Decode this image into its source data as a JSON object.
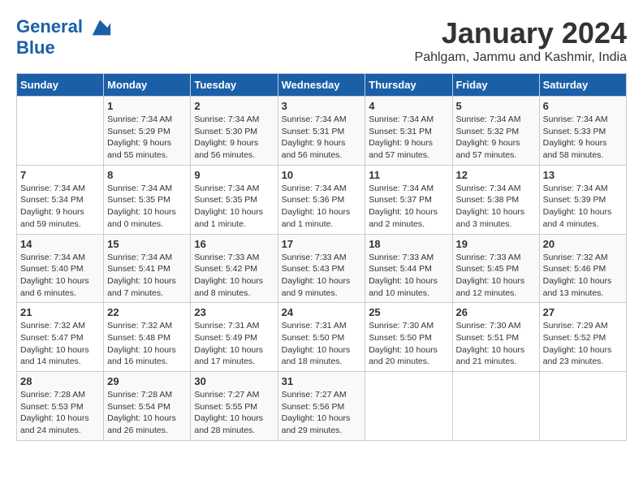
{
  "header": {
    "logo_line1": "General",
    "logo_line2": "Blue",
    "month_title": "January 2024",
    "subtitle": "Pahlgam, Jammu and Kashmir, India"
  },
  "days_of_week": [
    "Sunday",
    "Monday",
    "Tuesday",
    "Wednesday",
    "Thursday",
    "Friday",
    "Saturday"
  ],
  "weeks": [
    [
      {
        "day": "",
        "sunrise": "",
        "sunset": "",
        "daylight": ""
      },
      {
        "day": "1",
        "sunrise": "Sunrise: 7:34 AM",
        "sunset": "Sunset: 5:29 PM",
        "daylight": "Daylight: 9 hours and 55 minutes."
      },
      {
        "day": "2",
        "sunrise": "Sunrise: 7:34 AM",
        "sunset": "Sunset: 5:30 PM",
        "daylight": "Daylight: 9 hours and 56 minutes."
      },
      {
        "day": "3",
        "sunrise": "Sunrise: 7:34 AM",
        "sunset": "Sunset: 5:31 PM",
        "daylight": "Daylight: 9 hours and 56 minutes."
      },
      {
        "day": "4",
        "sunrise": "Sunrise: 7:34 AM",
        "sunset": "Sunset: 5:31 PM",
        "daylight": "Daylight: 9 hours and 57 minutes."
      },
      {
        "day": "5",
        "sunrise": "Sunrise: 7:34 AM",
        "sunset": "Sunset: 5:32 PM",
        "daylight": "Daylight: 9 hours and 57 minutes."
      },
      {
        "day": "6",
        "sunrise": "Sunrise: 7:34 AM",
        "sunset": "Sunset: 5:33 PM",
        "daylight": "Daylight: 9 hours and 58 minutes."
      }
    ],
    [
      {
        "day": "7",
        "sunrise": "Sunrise: 7:34 AM",
        "sunset": "Sunset: 5:34 PM",
        "daylight": "Daylight: 9 hours and 59 minutes."
      },
      {
        "day": "8",
        "sunrise": "Sunrise: 7:34 AM",
        "sunset": "Sunset: 5:35 PM",
        "daylight": "Daylight: 10 hours and 0 minutes."
      },
      {
        "day": "9",
        "sunrise": "Sunrise: 7:34 AM",
        "sunset": "Sunset: 5:35 PM",
        "daylight": "Daylight: 10 hours and 1 minute."
      },
      {
        "day": "10",
        "sunrise": "Sunrise: 7:34 AM",
        "sunset": "Sunset: 5:36 PM",
        "daylight": "Daylight: 10 hours and 1 minute."
      },
      {
        "day": "11",
        "sunrise": "Sunrise: 7:34 AM",
        "sunset": "Sunset: 5:37 PM",
        "daylight": "Daylight: 10 hours and 2 minutes."
      },
      {
        "day": "12",
        "sunrise": "Sunrise: 7:34 AM",
        "sunset": "Sunset: 5:38 PM",
        "daylight": "Daylight: 10 hours and 3 minutes."
      },
      {
        "day": "13",
        "sunrise": "Sunrise: 7:34 AM",
        "sunset": "Sunset: 5:39 PM",
        "daylight": "Daylight: 10 hours and 4 minutes."
      }
    ],
    [
      {
        "day": "14",
        "sunrise": "Sunrise: 7:34 AM",
        "sunset": "Sunset: 5:40 PM",
        "daylight": "Daylight: 10 hours and 6 minutes."
      },
      {
        "day": "15",
        "sunrise": "Sunrise: 7:34 AM",
        "sunset": "Sunset: 5:41 PM",
        "daylight": "Daylight: 10 hours and 7 minutes."
      },
      {
        "day": "16",
        "sunrise": "Sunrise: 7:33 AM",
        "sunset": "Sunset: 5:42 PM",
        "daylight": "Daylight: 10 hours and 8 minutes."
      },
      {
        "day": "17",
        "sunrise": "Sunrise: 7:33 AM",
        "sunset": "Sunset: 5:43 PM",
        "daylight": "Daylight: 10 hours and 9 minutes."
      },
      {
        "day": "18",
        "sunrise": "Sunrise: 7:33 AM",
        "sunset": "Sunset: 5:44 PM",
        "daylight": "Daylight: 10 hours and 10 minutes."
      },
      {
        "day": "19",
        "sunrise": "Sunrise: 7:33 AM",
        "sunset": "Sunset: 5:45 PM",
        "daylight": "Daylight: 10 hours and 12 minutes."
      },
      {
        "day": "20",
        "sunrise": "Sunrise: 7:32 AM",
        "sunset": "Sunset: 5:46 PM",
        "daylight": "Daylight: 10 hours and 13 minutes."
      }
    ],
    [
      {
        "day": "21",
        "sunrise": "Sunrise: 7:32 AM",
        "sunset": "Sunset: 5:47 PM",
        "daylight": "Daylight: 10 hours and 14 minutes."
      },
      {
        "day": "22",
        "sunrise": "Sunrise: 7:32 AM",
        "sunset": "Sunset: 5:48 PM",
        "daylight": "Daylight: 10 hours and 16 minutes."
      },
      {
        "day": "23",
        "sunrise": "Sunrise: 7:31 AM",
        "sunset": "Sunset: 5:49 PM",
        "daylight": "Daylight: 10 hours and 17 minutes."
      },
      {
        "day": "24",
        "sunrise": "Sunrise: 7:31 AM",
        "sunset": "Sunset: 5:50 PM",
        "daylight": "Daylight: 10 hours and 18 minutes."
      },
      {
        "day": "25",
        "sunrise": "Sunrise: 7:30 AM",
        "sunset": "Sunset: 5:50 PM",
        "daylight": "Daylight: 10 hours and 20 minutes."
      },
      {
        "day": "26",
        "sunrise": "Sunrise: 7:30 AM",
        "sunset": "Sunset: 5:51 PM",
        "daylight": "Daylight: 10 hours and 21 minutes."
      },
      {
        "day": "27",
        "sunrise": "Sunrise: 7:29 AM",
        "sunset": "Sunset: 5:52 PM",
        "daylight": "Daylight: 10 hours and 23 minutes."
      }
    ],
    [
      {
        "day": "28",
        "sunrise": "Sunrise: 7:28 AM",
        "sunset": "Sunset: 5:53 PM",
        "daylight": "Daylight: 10 hours and 24 minutes."
      },
      {
        "day": "29",
        "sunrise": "Sunrise: 7:28 AM",
        "sunset": "Sunset: 5:54 PM",
        "daylight": "Daylight: 10 hours and 26 minutes."
      },
      {
        "day": "30",
        "sunrise": "Sunrise: 7:27 AM",
        "sunset": "Sunset: 5:55 PM",
        "daylight": "Daylight: 10 hours and 28 minutes."
      },
      {
        "day": "31",
        "sunrise": "Sunrise: 7:27 AM",
        "sunset": "Sunset: 5:56 PM",
        "daylight": "Daylight: 10 hours and 29 minutes."
      },
      {
        "day": "",
        "sunrise": "",
        "sunset": "",
        "daylight": ""
      },
      {
        "day": "",
        "sunrise": "",
        "sunset": "",
        "daylight": ""
      },
      {
        "day": "",
        "sunrise": "",
        "sunset": "",
        "daylight": ""
      }
    ]
  ]
}
